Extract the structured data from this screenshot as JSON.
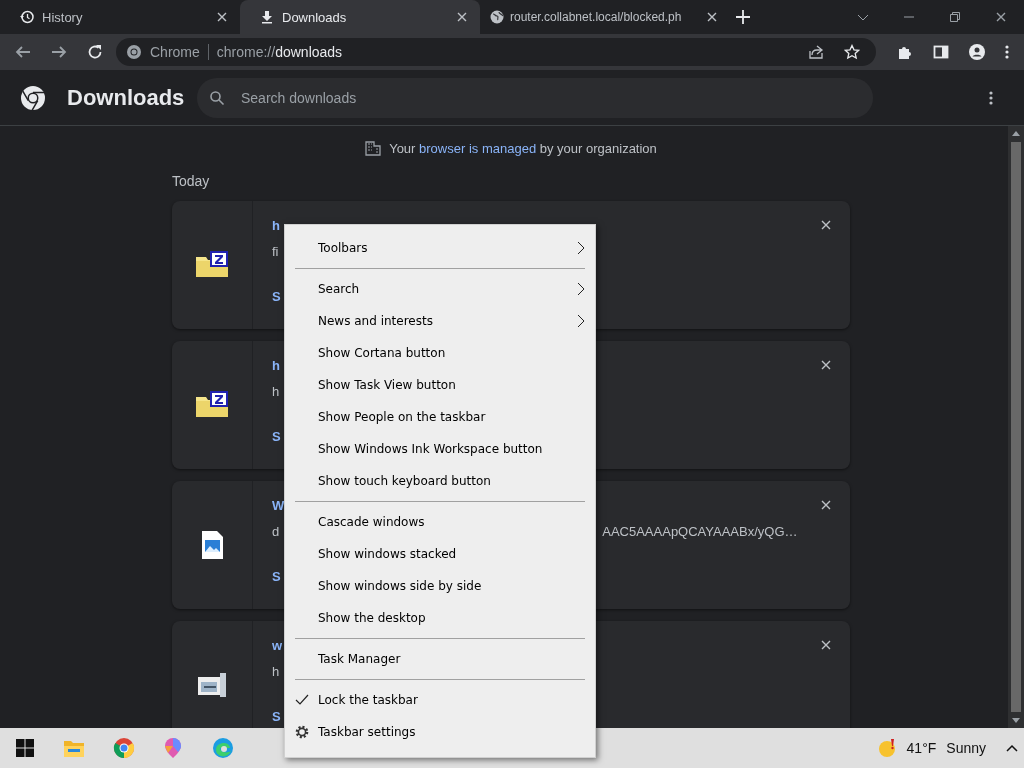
{
  "tabs": [
    {
      "title": "History",
      "selected": false
    },
    {
      "title": "Downloads",
      "selected": true
    },
    {
      "title": "router.collabnet.local/blocked.ph",
      "selected": false
    }
  ],
  "omnibox": {
    "site": "Chrome",
    "url_prefix": "chrome://",
    "url_host": "downloads"
  },
  "header": {
    "title": "Downloads",
    "search_placeholder": "Search downloads"
  },
  "managed_notice": {
    "before": "Your",
    "link": "browser is managed",
    "after": "by your organization"
  },
  "date_heading": "Today",
  "downloads": [
    {
      "kind": "zip",
      "name": "h",
      "detail": "fi",
      "action": "S"
    },
    {
      "kind": "zip",
      "name": "h",
      "detail": "h",
      "action": "S"
    },
    {
      "kind": "image",
      "name": "W",
      "detail": "d",
      "detail_tail": "AAC5AAAApQCAYAAABx/yQG…",
      "action": "S"
    },
    {
      "kind": "installer",
      "name": "w",
      "detail": "h",
      "action": "S"
    }
  ],
  "context_menu": {
    "sections": [
      [
        {
          "label": "Toolbars",
          "kind": "submenu"
        }
      ],
      [
        {
          "label": "Search",
          "kind": "submenu"
        },
        {
          "label": "News and interests",
          "kind": "submenu"
        },
        {
          "label": "Show Cortana button",
          "kind": "command"
        },
        {
          "label": "Show Task View button",
          "kind": "command"
        },
        {
          "label": "Show People on the taskbar",
          "kind": "command"
        },
        {
          "label": "Show Windows Ink Workspace button",
          "kind": "command"
        },
        {
          "label": "Show touch keyboard button",
          "kind": "command"
        }
      ],
      [
        {
          "label": "Cascade windows",
          "kind": "command"
        },
        {
          "label": "Show windows stacked",
          "kind": "command"
        },
        {
          "label": "Show windows side by side",
          "kind": "command"
        },
        {
          "label": "Show the desktop",
          "kind": "command"
        }
      ],
      [
        {
          "label": "Task Manager",
          "kind": "command"
        }
      ],
      [
        {
          "label": "Lock the taskbar",
          "kind": "check",
          "checked": true
        },
        {
          "label": "Taskbar settings",
          "kind": "settings"
        }
      ]
    ]
  },
  "taskbar": {
    "weather": {
      "temperature": "41°F",
      "condition": "Sunny"
    }
  }
}
